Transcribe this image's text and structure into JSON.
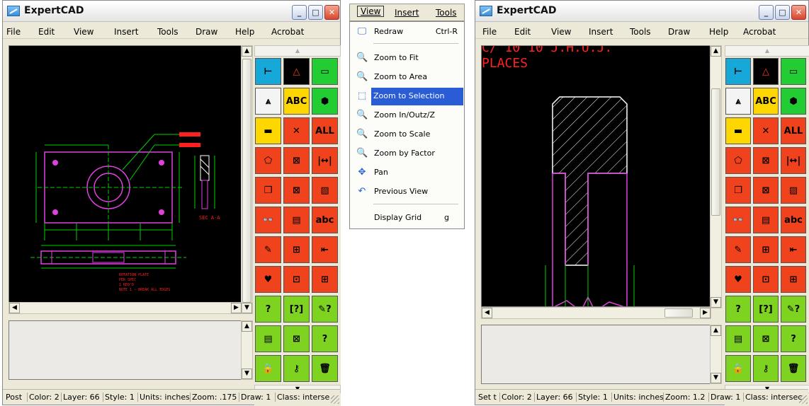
{
  "windows": [
    {
      "title": "ExpertCAD",
      "menu": [
        "File",
        "Edit",
        "View",
        "Insert",
        "Tools",
        "Draw",
        "Help",
        "Acrobat"
      ],
      "status": [
        "Post",
        "Color: 2",
        "Layer: 66",
        "Style: 1",
        "Units: inches",
        "Zoom: .175",
        "Draw: 1",
        "Class: interse"
      ],
      "drawing_text": {
        "section": "SEC A-A",
        "notes": [
          "ROTATION PLATE",
          "PER SPEC",
          "1 REQ'D",
          "NOTE 1 - BREAK ALL EDGES"
        ]
      }
    },
    {
      "title": "ExpertCAD",
      "menu": [
        "File",
        "Edit",
        "View",
        "Insert",
        "Tools",
        "Draw",
        "Help",
        "Acrobat"
      ],
      "status": [
        "Set t",
        "Color: 2",
        "Layer: 66",
        "Style: 1",
        "Units: inches",
        "Zoom: 1.2",
        "Draw: 1",
        "Class: intersec"
      ],
      "drawing_text": {
        "line1": "C/ 10 10 J.H.U.J.",
        "line2": "PLACES"
      }
    }
  ],
  "window_buttons": {
    "minimize": "_",
    "maximize": "□",
    "close": "✕"
  },
  "palette_tools": [
    {
      "name": "dimension-tool-icon",
      "glyph": "⊢",
      "color": "blue"
    },
    {
      "name": "triangle-tool-icon",
      "glyph": "△",
      "color": "black"
    },
    {
      "name": "ruler-tool-icon",
      "glyph": "▭",
      "color": "green"
    },
    {
      "name": "compass-tool-icon",
      "glyph": "⩓",
      "color": "white"
    },
    {
      "name": "text-tool-icon",
      "glyph": "ABC",
      "color": "yellow"
    },
    {
      "name": "solid-tool-icon",
      "glyph": "⬢",
      "color": "green"
    },
    {
      "name": "eraser-tool-icon",
      "glyph": "▬",
      "color": "yellow"
    },
    {
      "name": "delete-tool-icon",
      "glyph": "✕",
      "color": "red"
    },
    {
      "name": "all-tool-icon",
      "glyph": "ALL",
      "color": "red"
    },
    {
      "name": "shape-tool-icon",
      "glyph": "⬠",
      "color": "red"
    },
    {
      "name": "cross-box-tool-icon",
      "glyph": "⊠",
      "color": "red"
    },
    {
      "name": "width-tool-icon",
      "glyph": "|↔|",
      "color": "red"
    },
    {
      "name": "copy-tool-icon",
      "glyph": "❐",
      "color": "red"
    },
    {
      "name": "select-box-tool-icon",
      "glyph": "⊠",
      "color": "red"
    },
    {
      "name": "hatch-tool-icon",
      "glyph": "▨",
      "color": "red"
    },
    {
      "name": "binoculars-tool-icon",
      "glyph": "👓",
      "color": "red"
    },
    {
      "name": "document-tool-icon",
      "glyph": "▤",
      "color": "red"
    },
    {
      "name": "abc-text-tool-icon",
      "glyph": "abc",
      "color": "red"
    },
    {
      "name": "pencil-tool-icon",
      "glyph": "✎",
      "color": "red"
    },
    {
      "name": "grid-select-tool-icon",
      "glyph": "⊞",
      "color": "red"
    },
    {
      "name": "insert-tool-icon",
      "glyph": "⇤",
      "color": "red"
    },
    {
      "name": "heart-tool-icon",
      "glyph": "♥",
      "color": "red"
    },
    {
      "name": "block-tool-icon",
      "glyph": "⊡",
      "color": "red"
    },
    {
      "name": "table-tool-icon",
      "glyph": "⊞",
      "color": "red"
    },
    {
      "name": "help-doc-tool-icon",
      "glyph": "?",
      "color": "lgreen"
    },
    {
      "name": "help-box-tool-icon",
      "glyph": "[?]",
      "color": "lgreen"
    },
    {
      "name": "help-pencil-tool-icon",
      "glyph": "✎?",
      "color": "lgreen"
    },
    {
      "name": "page-tool-icon",
      "glyph": "▤",
      "color": "lgreen"
    },
    {
      "name": "cancel-page-tool-icon",
      "glyph": "⊠",
      "color": "lgreen"
    },
    {
      "name": "help-page-tool-icon",
      "glyph": "?",
      "color": "lgreen"
    },
    {
      "name": "lock-tool-icon",
      "glyph": "🔒",
      "color": "lgreen"
    },
    {
      "name": "key-tool-icon",
      "glyph": "⚷",
      "color": "lgreen"
    },
    {
      "name": "trash-tool-icon",
      "glyph": "🗑",
      "color": "lgreen"
    }
  ],
  "dropdown": {
    "menubar": [
      "View",
      "Insert",
      "Tools"
    ],
    "items": [
      {
        "icon": "redraw-icon",
        "glyph": "🖵",
        "label": "Redraw",
        "shortcut": "Ctrl-R"
      },
      {
        "icon": "zoom-fit-icon",
        "glyph": "🔍",
        "label": "Zoom to Fit",
        "shortcut": ""
      },
      {
        "icon": "zoom-area-icon",
        "glyph": "🔍",
        "label": "Zoom to Area",
        "shortcut": ""
      },
      {
        "icon": "zoom-selection-icon",
        "glyph": "⬚",
        "label": "Zoom to Selection",
        "shortcut": ""
      },
      {
        "icon": "zoom-inout-icon",
        "glyph": "🔍",
        "label": "Zoom In/Out",
        "shortcut": "z/Z"
      },
      {
        "icon": "zoom-scale-icon",
        "glyph": "🔍",
        "label": "Zoom to Scale",
        "shortcut": ""
      },
      {
        "icon": "zoom-factor-icon",
        "glyph": "🔍",
        "label": "Zoom by Factor",
        "shortcut": ""
      },
      {
        "icon": "pan-icon",
        "glyph": "✥",
        "label": "Pan",
        "shortcut": ""
      },
      {
        "icon": "previous-view-icon",
        "glyph": "↶",
        "label": "Previous View",
        "shortcut": ""
      },
      {
        "icon": "",
        "glyph": "",
        "label": "Display Grid",
        "shortcut": "g"
      }
    ],
    "selected_index": 3
  },
  "colors": {
    "magenta": "#e040e0",
    "green": "#00d000",
    "red": "#ff2020",
    "white": "#ffffff",
    "selection": "#2a5cd6"
  }
}
